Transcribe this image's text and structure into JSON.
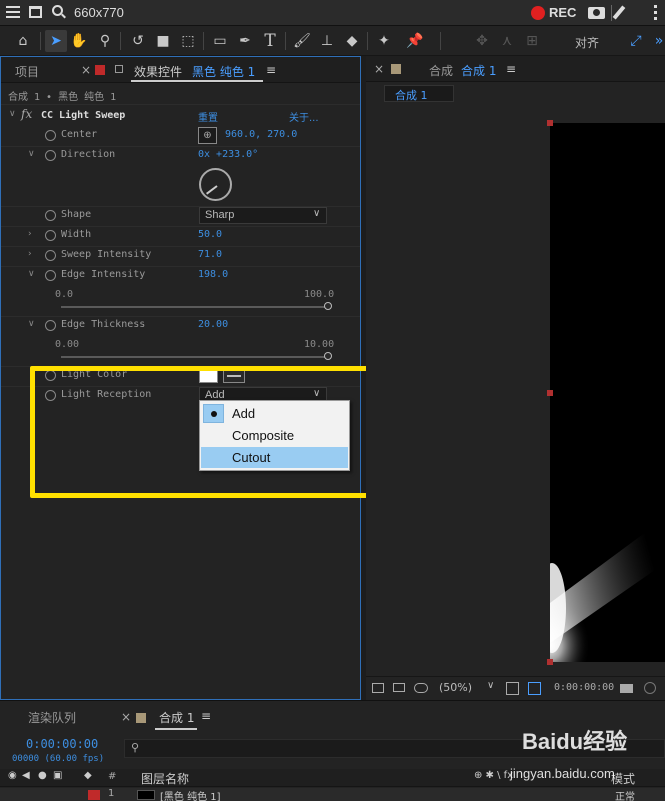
{
  "recorder": {
    "title": "660x770",
    "rec_label": "REC"
  },
  "toolbar": {
    "align_label": "对齐"
  },
  "effect_panel": {
    "tab_project": "项目",
    "tab_effects_prefix": "效果控件",
    "tab_effects_layer": "黑色 纯色 1",
    "breadcrumb": "合成 1 • 黑色 纯色 1",
    "effect_name": "CC Light Sweep",
    "reset_label": "重置",
    "about_label": "关于...",
    "properties": {
      "center": {
        "label": "Center",
        "value": "960.0, 270.0"
      },
      "direction": {
        "label": "Direction",
        "value": "0x +233.0°",
        "angle": 233
      },
      "shape": {
        "label": "Shape",
        "value": "Sharp"
      },
      "width": {
        "label": "Width",
        "value": "50.0"
      },
      "sweep_intensity": {
        "label": "Sweep Intensity",
        "value": "71.0"
      },
      "edge_intensity": {
        "label": "Edge Intensity",
        "value": "198.0",
        "min": "0.0",
        "max": "100.0"
      },
      "edge_thickness": {
        "label": "Edge Thickness",
        "value": "20.00",
        "min": "0.00",
        "max": "10.00"
      },
      "light_color": {
        "label": "Light Color",
        "color": "#ffffff"
      },
      "light_reception": {
        "label": "Light Reception",
        "value": "Add"
      }
    },
    "dropdown": {
      "options": [
        "Add",
        "Composite",
        "Cutout"
      ],
      "checked": "Add",
      "highlighted": "Cutout"
    }
  },
  "comp_panel": {
    "tab_prefix": "合成",
    "tab_name": "合成 1",
    "subtab": "合成 1",
    "zoom": "(50%)",
    "timecode": "0:00:00:00"
  },
  "timeline": {
    "tab_render": "渲染队列",
    "tab_comp": "合成 1",
    "timecode": "0:00:00:00",
    "fps": "00000 (60.00 fps)",
    "col_hash": "#",
    "col_layer_name": "图层名称",
    "col_mode": "模式",
    "mode_value": "正常",
    "layer_num": "1",
    "layer_name": "[黑色 纯色 1]"
  },
  "watermark": {
    "brand": "Baidu经验",
    "url": "jingyan.baidu.com"
  },
  "colors": {
    "accent_blue": "#3d8ee0",
    "highlight_yellow": "#ffe000",
    "menu_selected": "#99ccf2",
    "rec_red": "#e02020"
  }
}
